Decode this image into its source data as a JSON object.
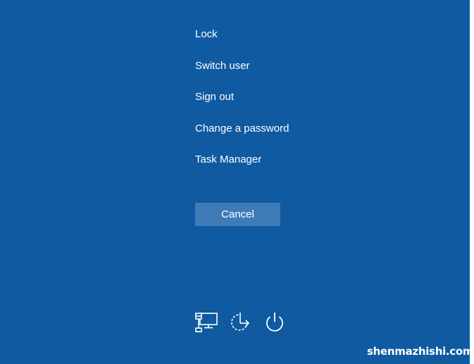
{
  "menu": {
    "items": [
      {
        "label": "Lock"
      },
      {
        "label": "Switch user"
      },
      {
        "label": "Sign out"
      },
      {
        "label": "Change a password"
      },
      {
        "label": "Task Manager"
      }
    ]
  },
  "cancel_label": "Cancel",
  "bottom_icons": [
    "network-icon",
    "ease-of-access-icon",
    "power-icon"
  ],
  "watermark": "shenmazhishi.com",
  "colors": {
    "background": "#0f5aa1",
    "button": "#3f7cb7",
    "text": "#ffffff"
  }
}
